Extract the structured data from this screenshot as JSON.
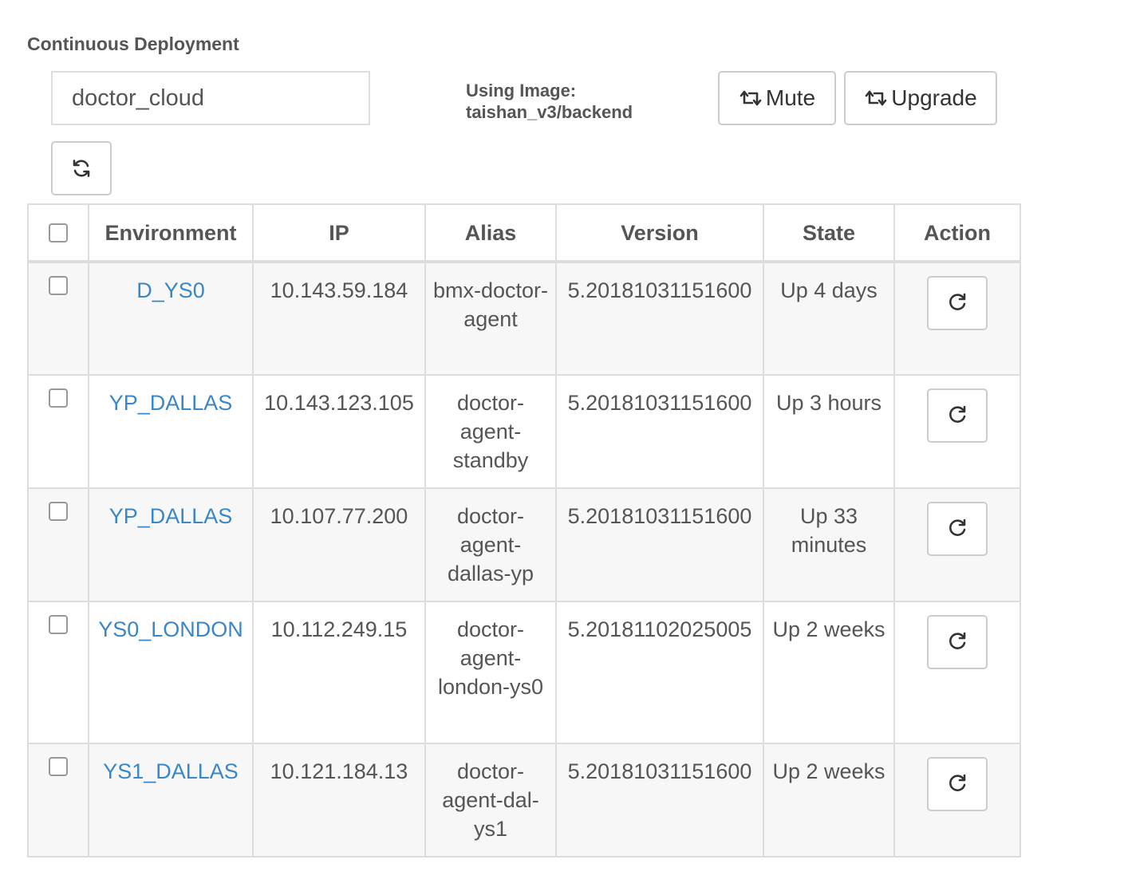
{
  "header": {
    "title": "Continuous Deployment",
    "app_name": "doctor_cloud",
    "image_label": "Using Image:",
    "image_value": "taishan_v3/backend",
    "mute_label": "Mute",
    "upgrade_label": "Upgrade"
  },
  "table": {
    "columns": [
      "Environment",
      "IP",
      "Alias",
      "Version",
      "State",
      "Action"
    ],
    "rows": [
      {
        "environment": "D_YS0",
        "ip": "10.143.59.184",
        "alias": "bmx-doctor-agent",
        "version": "5.20181031151600",
        "state": "Up 4 days"
      },
      {
        "environment": "YP_DALLAS",
        "ip": "10.143.123.105",
        "alias": "doctor-agent-standby",
        "version": "5.20181031151600",
        "state": "Up 3 hours"
      },
      {
        "environment": "YP_DALLAS",
        "ip": "10.107.77.200",
        "alias": "doctor-agent-dallas-yp",
        "version": "5.20181031151600",
        "state": "Up 33 minutes"
      },
      {
        "environment": "YS0_LONDON",
        "ip": "10.112.249.15",
        "alias": "doctor-agent-london-ys0",
        "version": "5.20181102025005",
        "state": "Up 2 weeks"
      },
      {
        "environment": "YS1_DALLAS",
        "ip": "10.121.184.13",
        "alias": "doctor-agent-dal-ys1",
        "version": "5.20181031151600",
        "state": "Up 2 weeks"
      }
    ]
  },
  "colors": {
    "link": "#3a87c8",
    "border": "#dddddd",
    "stripe": "#f7f7f7"
  },
  "icons": {
    "mute": "retweet-icon",
    "upgrade": "retweet-icon",
    "refresh": "sync-icon",
    "row_action": "redo-icon"
  }
}
